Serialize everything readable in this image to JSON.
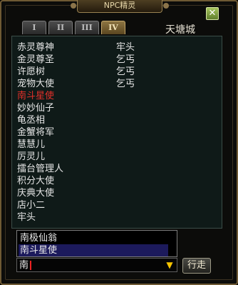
{
  "window": {
    "title": "NPC精灵",
    "close_label": "✕"
  },
  "tabs": [
    "I",
    "II",
    "III",
    "IV"
  ],
  "active_tab": 3,
  "city": "天塘城",
  "npc_left": [
    "赤灵尊神",
    "金灵尊圣",
    "许愿树",
    "宠物大使",
    "南斗星使",
    "妙妙仙子",
    "龟丞相",
    "金蟹将军",
    "慧慧儿",
    "厉灵儿",
    "擂台管理人",
    "积分大使",
    "庆典大使",
    "店小二",
    "牢头"
  ],
  "npc_left_highlight_index": 4,
  "npc_right": [
    "牢头",
    "乞丐",
    "乞丐",
    "乞丐"
  ],
  "dropdown": {
    "items": [
      "南极仙翁",
      "南斗星使"
    ],
    "selected_index": 1
  },
  "input": {
    "value": "南"
  },
  "go_button": {
    "label": "行走"
  },
  "colors": {
    "highlight": "#e2302a",
    "arrow": "#f6c400",
    "selected_row": "#1c1a5c"
  }
}
